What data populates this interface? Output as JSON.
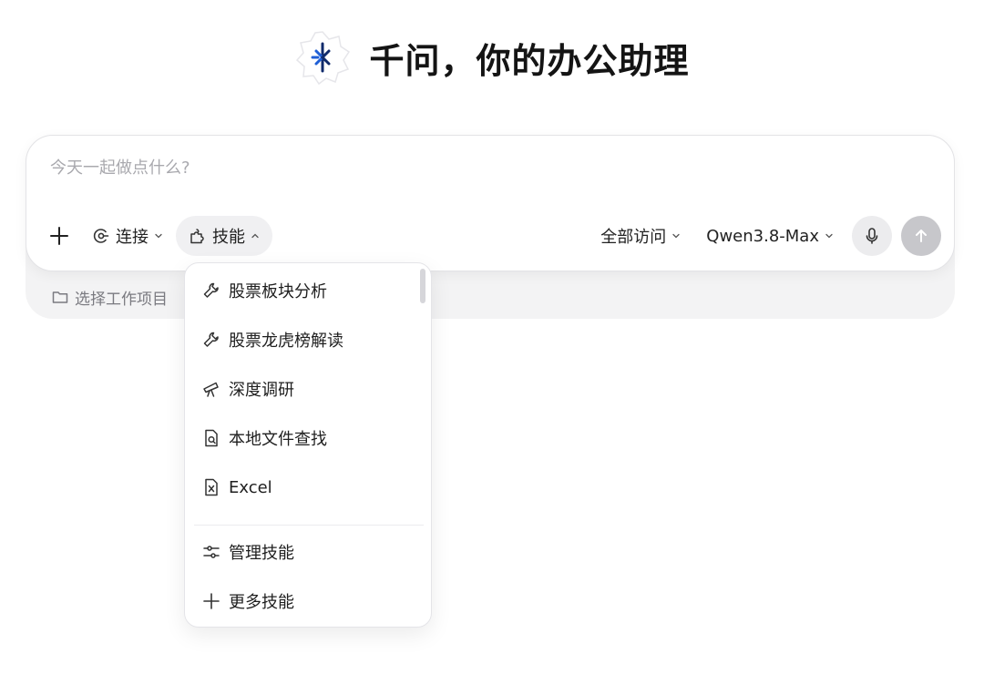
{
  "header": {
    "title": "千问，你的办公助理",
    "logo_icon": "qwen-logo-icon"
  },
  "composer": {
    "placeholder": "今天一起做点什么?",
    "value": "",
    "add_icon": "plus-icon",
    "connect": {
      "label": "连接",
      "icon": "connect-icon"
    },
    "skills": {
      "label": "技能",
      "icon": "puzzle-icon",
      "expanded": true
    },
    "access": {
      "label": "全部访问"
    },
    "model": {
      "label": "Qwen3.8-Max"
    },
    "mic_icon": "microphone-icon",
    "send_icon": "arrow-up-icon",
    "project": {
      "label": "选择工作项目",
      "icon": "folder-icon"
    }
  },
  "skills_menu": {
    "items": [
      {
        "label": "股票板块分析",
        "icon": "wrench-icon"
      },
      {
        "label": "股票龙虎榜解读",
        "icon": "wrench-icon"
      },
      {
        "label": "深度调研",
        "icon": "telescope-icon"
      },
      {
        "label": "本地文件查找",
        "icon": "file-search-icon"
      },
      {
        "label": "Excel",
        "icon": "excel-file-icon"
      }
    ],
    "footer": [
      {
        "label": "管理技能",
        "icon": "sliders-icon"
      },
      {
        "label": "更多技能",
        "icon": "plus-icon"
      }
    ]
  },
  "colors": {
    "accent": "#1f5fd6",
    "send_disabled": "#c7c7cb",
    "placeholder": "#a9a9ae"
  }
}
